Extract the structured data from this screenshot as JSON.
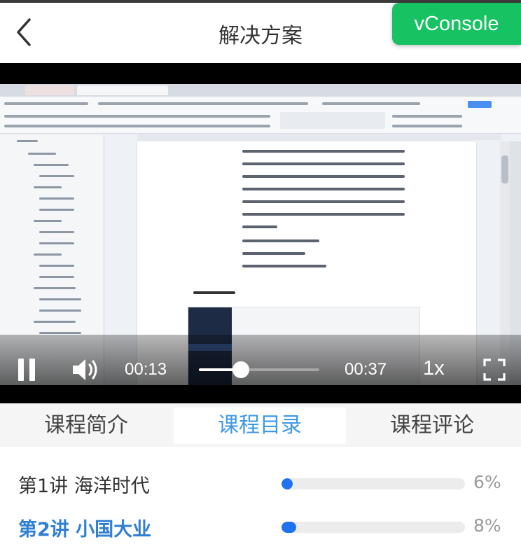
{
  "header": {
    "title": "解决方案",
    "vconsole_label": "vConsole"
  },
  "player": {
    "current_time": "00:13",
    "duration": "00:37",
    "played_fraction": 0.35,
    "speed": "1x"
  },
  "tabs": [
    {
      "label": "课程简介",
      "active": false
    },
    {
      "label": "课程目录",
      "active": true
    },
    {
      "label": "课程评论",
      "active": false
    }
  ],
  "lessons": [
    {
      "title": "第1讲 海洋时代",
      "progress_percent": 6,
      "progress_label": "6%",
      "active": false
    },
    {
      "title": "第2讲 小国大业",
      "progress_percent": 8,
      "progress_label": "8%",
      "active": true
    }
  ],
  "colors": {
    "accent": "#3e98e4",
    "active_lesson": "#2f7fd3",
    "progress_fill": "#1f73f0",
    "vconsole": "#17c263"
  }
}
